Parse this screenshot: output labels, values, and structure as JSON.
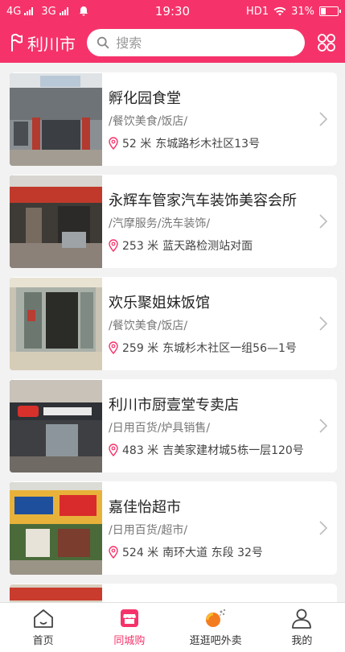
{
  "status": {
    "left_1": "4G",
    "left_2": "3G",
    "time": "19:30",
    "hd": "HD1",
    "battery": "31%",
    "battery_level": 0.31
  },
  "header": {
    "city": "利川市",
    "search_placeholder": "搜索"
  },
  "shops": [
    {
      "name": "孵化园食堂",
      "category": "/餐饮美食/饭店/",
      "distance": "52 米",
      "address": "东城路杉木社区13号"
    },
    {
      "name": "永辉车管家汽车装饰美容会所",
      "category": "/汽摩服务/洗车装饰/",
      "distance": "253 米",
      "address": "蓝天路检测站对面"
    },
    {
      "name": "欢乐聚姐妹饭馆",
      "category": "/餐饮美食/饭店/",
      "distance": "259 米",
      "address": "东城杉木社区一组56—1号"
    },
    {
      "name": "利川市厨壹堂专卖店",
      "category": "/日用百货/炉具销售/",
      "distance": "483 米",
      "address": "吉美家建材城5栋一层120号"
    },
    {
      "name": "嘉佳怡超市",
      "category": "/日用百货/超市/",
      "distance": "524 米",
      "address": "南环大道 东段 32号"
    }
  ],
  "tabs": [
    {
      "label": "首页",
      "icon": "home-icon"
    },
    {
      "label": "同城购",
      "icon": "store-icon"
    },
    {
      "label": "逛逛吧外卖",
      "icon": "takeout-icon"
    },
    {
      "label": "我的",
      "icon": "user-icon"
    }
  ],
  "colors": {
    "accent": "#f5336a"
  }
}
